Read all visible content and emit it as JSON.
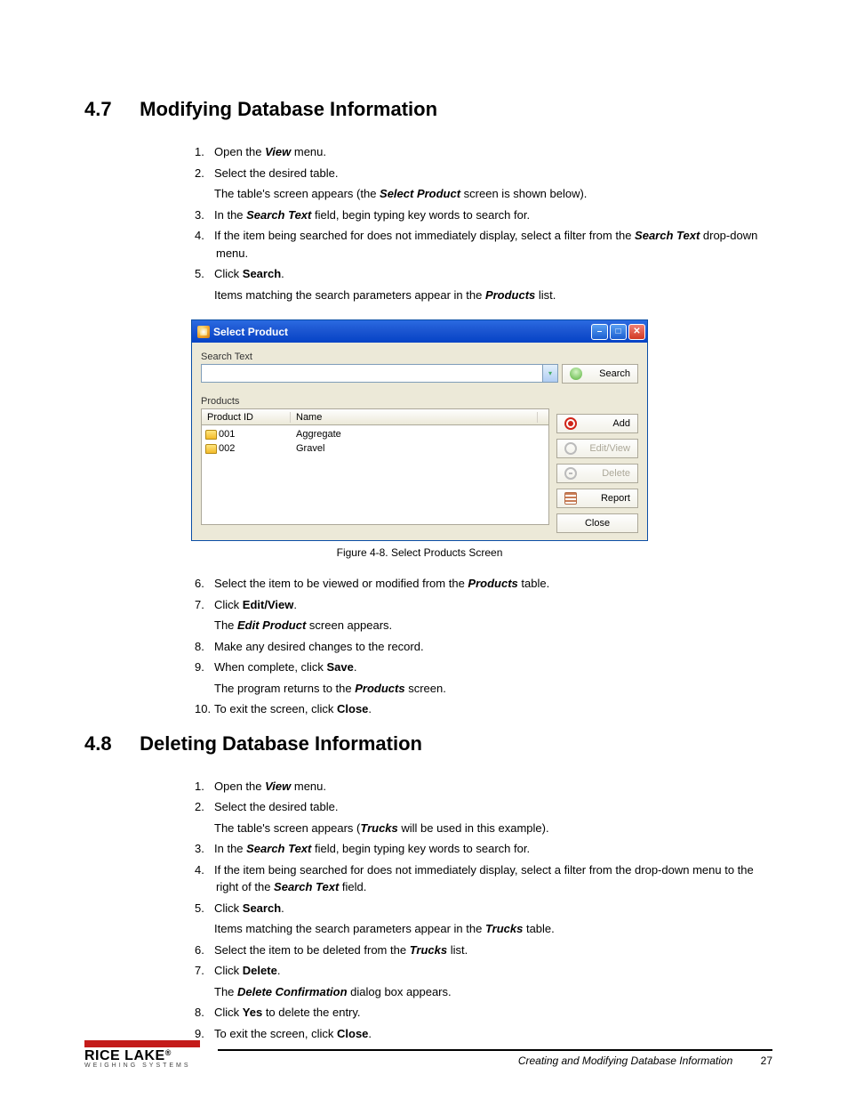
{
  "section47": {
    "num": "4.7",
    "title": "Modifying Database Information",
    "steps": [
      {
        "n": "1.",
        "t": [
          "Open the ",
          {
            "i": "View"
          },
          " menu."
        ]
      },
      {
        "n": "2.",
        "t": [
          "Select the desired table."
        ]
      },
      {
        "n": "",
        "t": [
          "The table's screen appears (the ",
          {
            "i": "Select Product"
          },
          " screen is shown below)."
        ]
      },
      {
        "n": "3.",
        "t": [
          "In the ",
          {
            "i": "Search Text"
          },
          " field, begin typing key words to search for."
        ]
      },
      {
        "n": "4.",
        "t": [
          "If the item being searched for does not immediately display, select a filter from the ",
          {
            "i": "Search Text"
          },
          " drop-down menu."
        ]
      },
      {
        "n": "5.",
        "t": [
          "Click ",
          {
            "b": "Search"
          },
          "."
        ]
      },
      {
        "n": "",
        "t": [
          "Items matching the search parameters appear in the ",
          {
            "i": "Products"
          },
          " list."
        ]
      }
    ],
    "steps_b": [
      {
        "n": "6.",
        "t": [
          "Select the item to be viewed or modified from the ",
          {
            "i": "Products"
          },
          " table."
        ]
      },
      {
        "n": "7.",
        "t": [
          "Click ",
          {
            "b": "Edit/View"
          },
          "."
        ]
      },
      {
        "n": "",
        "t": [
          "The ",
          {
            "i": "Edit Product"
          },
          " screen appears."
        ]
      },
      {
        "n": "8.",
        "t": [
          "Make any desired changes to the record."
        ]
      },
      {
        "n": "9.",
        "t": [
          "When complete, click ",
          {
            "b": "Save"
          },
          "."
        ]
      },
      {
        "n": "",
        "t": [
          "The program returns to the ",
          {
            "i": "Products"
          },
          " screen."
        ]
      },
      {
        "n": "10.",
        "t": [
          "To exit the screen, click ",
          {
            "b": "Close"
          },
          "."
        ]
      }
    ]
  },
  "section48": {
    "num": "4.8",
    "title": "Deleting Database Information",
    "steps": [
      {
        "n": "1.",
        "t": [
          "Open the ",
          {
            "i": "View"
          },
          " menu."
        ]
      },
      {
        "n": "2.",
        "t": [
          "Select the desired table."
        ]
      },
      {
        "n": "",
        "t": [
          "The table's screen appears (",
          {
            "i": "Trucks"
          },
          " will be used in this example)."
        ]
      },
      {
        "n": "3.",
        "t": [
          "In the ",
          {
            "i": "Search Text"
          },
          " field, begin typing key words to search for."
        ]
      },
      {
        "n": "4.",
        "t": [
          "If the item being searched for does not immediately display, select a filter from the drop-down menu to the right of the ",
          {
            "i": "Search Text"
          },
          " field."
        ]
      },
      {
        "n": "5.",
        "t": [
          "Click ",
          {
            "b": "Search"
          },
          "."
        ]
      },
      {
        "n": "",
        "t": [
          "Items matching the search parameters appear in the ",
          {
            "i": "Trucks"
          },
          " table."
        ]
      },
      {
        "n": "6.",
        "t": [
          "Select the item to be deleted from the ",
          {
            "i": "Trucks"
          },
          " list."
        ]
      },
      {
        "n": "7.",
        "t": [
          "Click ",
          {
            "b": "Delete"
          },
          "."
        ]
      },
      {
        "n": "",
        "t": [
          "The ",
          {
            "i": "Delete Confirmation"
          },
          " dialog box appears."
        ]
      },
      {
        "n": "8.",
        "t": [
          "Click ",
          {
            "b": "Yes"
          },
          " to delete the entry."
        ]
      },
      {
        "n": "9.",
        "t": [
          "To exit the screen, click ",
          {
            "b": "Close"
          },
          "."
        ]
      }
    ]
  },
  "dialog": {
    "title": "Select Product",
    "search_label": "Search Text",
    "search_btn": "Search",
    "products_lbl": "Products",
    "col1": "Product ID",
    "col2": "Name",
    "rows": [
      {
        "id": "001",
        "name": "Aggregate"
      },
      {
        "id": "002",
        "name": "Gravel"
      }
    ],
    "btn_add": "Add",
    "btn_ev": "Edit/View",
    "btn_del": "Delete",
    "btn_rep": "Report",
    "btn_close": "Close",
    "caption": "Figure 4-8. Select Products Screen"
  },
  "footer": {
    "brand_top": "RICE LAKE",
    "brand_sub": "WEIGHING SYSTEMS",
    "title": "Creating and Modifying Database Information",
    "page": "27"
  }
}
